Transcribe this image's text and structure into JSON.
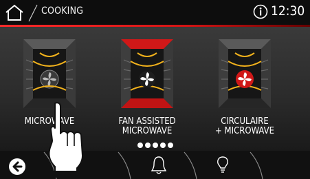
{
  "header": {
    "title": "COOKING",
    "time": "12:30"
  },
  "modes": [
    {
      "label": "MICROWAVE",
      "selected": false
    },
    {
      "label": "FAN ASSISTED MICROWAVE",
      "label_line1": "FAN ASSISTED",
      "label_line2": "MICROWAVE",
      "selected": false
    },
    {
      "label": "CIRCULAIRE + MICROWAVE",
      "label_line1": "CIRCULAIRE",
      "label_line2": "+ MICROWAVE",
      "selected": false
    }
  ],
  "pagination": {
    "pages": 5
  },
  "colors": {
    "accent": "#e0201c",
    "heat_arcs": "#f2b21c"
  },
  "icons": [
    "home-icon",
    "info-icon",
    "back-icon",
    "bell-icon",
    "bulb-icon",
    "hand-pointer-icon"
  ]
}
